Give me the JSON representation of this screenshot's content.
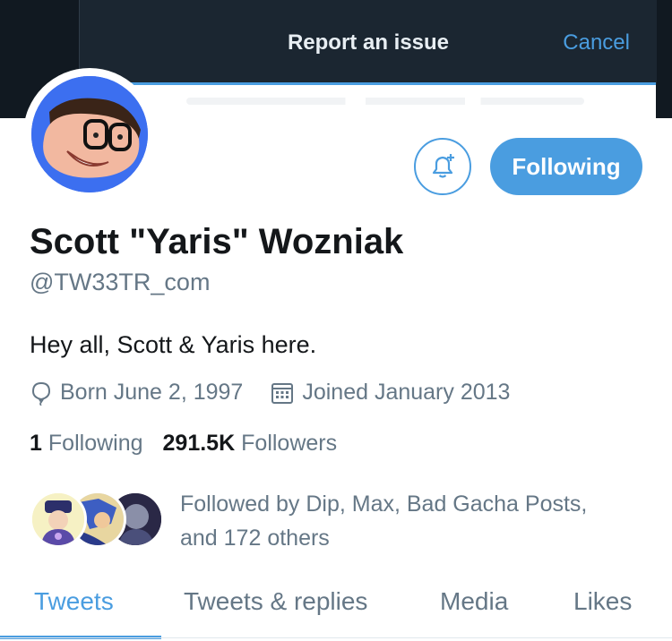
{
  "modal": {
    "title": "Report an issue",
    "cancel_label": "Cancel"
  },
  "profile": {
    "name": "Scott \"Yaris\" Wozniak",
    "handle": "@TW33TR_com",
    "bio": "Hey all, Scott & Yaris here.",
    "born": "Born June 2, 1997",
    "joined": "Joined January 2013",
    "following_count": "1",
    "following_label": "Following",
    "followers_count": "291.5K",
    "followers_label": "Followers",
    "follow_button_label": "Following",
    "followed_by_line1": "Followed by Dip, Max, Bad Gacha Posts,",
    "followed_by_line2": "and 172 others"
  },
  "tabs": [
    {
      "label": "Tweets",
      "active": true
    },
    {
      "label": "Tweets & replies",
      "active": false
    },
    {
      "label": "Media",
      "active": false
    },
    {
      "label": "Likes",
      "active": false
    }
  ],
  "colors": {
    "accent": "#4a9de0",
    "header_bg": "#111921",
    "text_primary": "#14171a",
    "text_secondary": "#657786"
  },
  "icons": [
    "bell-plus-icon",
    "birthday-balloon-icon",
    "calendar-icon"
  ]
}
